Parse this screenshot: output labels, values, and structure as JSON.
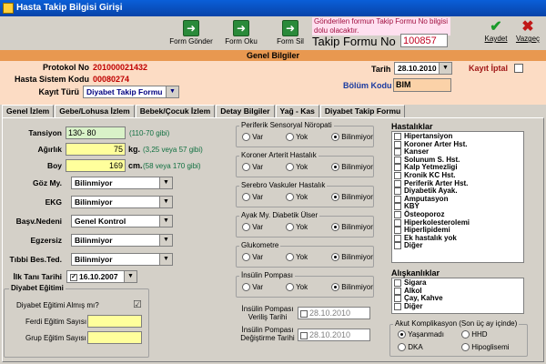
{
  "window": {
    "title": "Hasta Takip Bilgisi Girişi"
  },
  "toolbar": {
    "form_gonder": "Form Gönder",
    "form_oku": "Form Oku",
    "form_sil": "Form Sil",
    "notice": "Gönderilen formun Takip Formu No bilgisi dolu olacaktır.",
    "takip_formu_label": "Takip Formu No",
    "takip_formu_no": "100857",
    "kaydet": "Kaydet",
    "vazgec": "Vazgeç"
  },
  "genel": {
    "header": "Genel Bilgiler",
    "protokol_label": "Protokol No",
    "protokol_value": "201000021432",
    "sistem_label": "Hasta Sistem Kodu",
    "sistem_value": "00080274",
    "kayit_turu_label": "Kayıt Türü",
    "kayit_turu_value": "Diyabet Takip Formu",
    "tarih_label": "Tarih",
    "tarih_value": "28.10.2010",
    "kayit_iptal_label": "Kayıt İptal",
    "bolum_label": "Bölüm Kodu",
    "bolum_value": "BIM"
  },
  "tabs": [
    "Genel İzlem",
    "Gebe/Lohusa İzlem",
    "Bebek/Çocuk İzlem",
    "Detay Bilgiler",
    "Yağ - Kas",
    "Diyabet Takip Formu"
  ],
  "form": {
    "tansiyon_label": "Tansiyon",
    "tansiyon_value": "130- 80",
    "tansiyon_hint": "(110-70 gibi)",
    "agirlik_label": "Ağırlık",
    "agirlik_value": "75",
    "agirlik_unit": "kg.",
    "agirlik_hint": "(3,25 veya 57 gibi)",
    "boy_label": "Boy",
    "boy_value": "169",
    "boy_unit": "cm.",
    "boy_hint": "(58 veya 170 gibi)",
    "goz_label": "Göz My.",
    "goz_value": "Bilinmiyor",
    "ekg_label": "EKG",
    "ekg_value": "Bilinmiyor",
    "basv_label": "Başv.Nedeni",
    "basv_value": "Genel Kontrol",
    "egzersiz_label": "Egzersiz",
    "egzersiz_value": "Bilinmiyor",
    "tibbi_label": "Tıbbi Bes.Ted.",
    "tibbi_value": "Bilinmiyor",
    "ilk_tani_label": "İlk Tanı Tarihi",
    "ilk_tani_value": "16.10.2007",
    "egitim_title": "Diyabet Eğitimi",
    "egitim_alinmis": "Diyabet Eğitimi Almış mı?",
    "ferdi": "Ferdi Eğitim Sayısı",
    "grup": "Grup Eğitim Sayısı"
  },
  "radio_groups": [
    {
      "title": "Periferik Sensoryal Nöropati",
      "selected": "Bilinmiyor"
    },
    {
      "title": "Koroner Arterit Hastalık",
      "selected": "Bilinmiyor"
    },
    {
      "title": "Serebro Vaskuler Hastalık",
      "selected": "Bilinmiyor"
    },
    {
      "title": "Ayak My. Diabetik Ülser",
      "selected": "Bilinmiyor"
    },
    {
      "title": "Glukometre",
      "selected": "Bilinmiyor"
    },
    {
      "title": "İnsülin Pompası",
      "selected": "Bilinmiyor"
    }
  ],
  "radio_options": {
    "var": "Var",
    "yok": "Yok",
    "bilinmiyor": "Bilinmiyor"
  },
  "insulin": {
    "verilis_label": "İnsülin Pompası Veriliş Tarihi",
    "verilis_value": "28.10.2010",
    "degistirme_label": "İnsülin Pompası Değiştirme Tarihi",
    "degistirme_value": "28.10.2010"
  },
  "hastaliklar": {
    "title": "Hastalıklar",
    "items": [
      "Hipertansiyon",
      "Koroner Arter Hst.",
      "Kanser",
      "Solunum S. Hst.",
      "Kalp Yetmezligi",
      "Kronik KC Hst.",
      "Periferik Arter Hst.",
      "Diyabetik Ayak.",
      "Amputasyon",
      "KBY",
      "Östeoporoz",
      "Hiperkolesterolemi",
      "Hiperlipidemi",
      "Ek hastalık yok",
      "Diğer"
    ]
  },
  "aliskanliklar": {
    "title": "Alışkanlıklar",
    "items": [
      "Sigara",
      "Alkol",
      "Çay, Kahve",
      "Diğer"
    ]
  },
  "akut": {
    "title": "Akut Komplikasyon (Son üç ay içinde)",
    "options": [
      "Yaşanmadı",
      "HHD",
      "DKA",
      "Hipoglisemi"
    ],
    "selected": "Yaşanmadı"
  }
}
